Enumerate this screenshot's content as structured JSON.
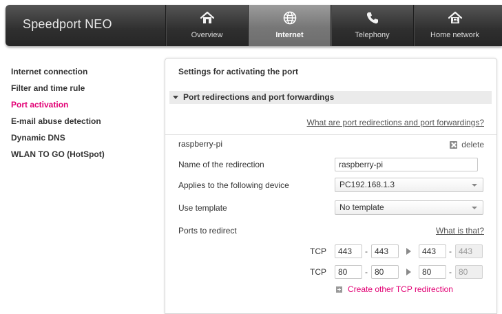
{
  "brand": "Speedport NEO",
  "nav": [
    {
      "label": "Overview",
      "icon": "house-icon",
      "active": false
    },
    {
      "label": "Internet",
      "icon": "globe-icon",
      "active": true
    },
    {
      "label": "Telephony",
      "icon": "phone-icon",
      "active": false
    },
    {
      "label": "Home network",
      "icon": "home-network-icon",
      "active": false
    }
  ],
  "sidebar": {
    "items": [
      {
        "label": "Internet connection"
      },
      {
        "label": "Filter and time rule"
      },
      {
        "label": "Port activation",
        "active": true
      },
      {
        "label": "E-mail abuse detection"
      },
      {
        "label": "Dynamic DNS"
      },
      {
        "label": "WLAN TO GO (HotSpot)"
      }
    ]
  },
  "main": {
    "title": "Settings for activating the port",
    "section_title": "Port redirections and port forwardings",
    "help_link": "What are port redirections and port forwardings?",
    "entry": {
      "name": "raspberry-pi",
      "delete_label": "delete",
      "name_label": "Name of the redirection",
      "name_value": "raspberry-pi",
      "device_label": "Applies to the following device",
      "device_value": "PC192.168.1.3",
      "template_label": "Use template",
      "template_value": "No template",
      "ports_label": "Ports to redirect",
      "what_link": "What is that?",
      "rules": [
        {
          "protocol": "TCP",
          "from_start": "443",
          "from_end": "443",
          "to_start": "443",
          "to_end": "443"
        },
        {
          "protocol": "TCP",
          "from_start": "80",
          "from_end": "80",
          "to_start": "80",
          "to_end": "80"
        }
      ],
      "dash": "-",
      "create_label": "Create other TCP redirection"
    }
  },
  "colors": {
    "accent": "#e20074",
    "topbar": "#2f2f2f",
    "active_tab": "#8a8a8a"
  }
}
